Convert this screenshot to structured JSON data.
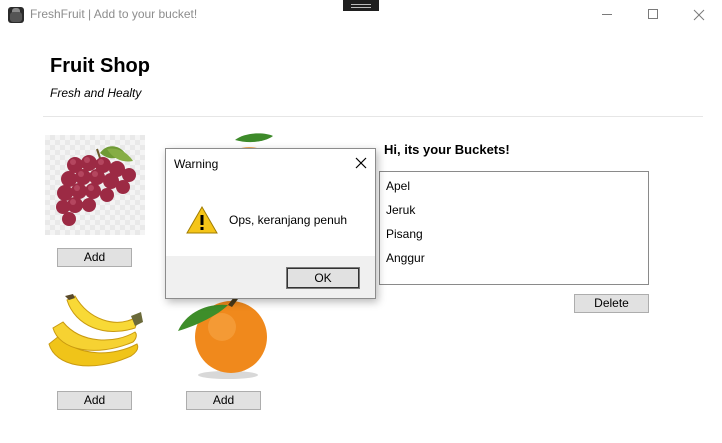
{
  "window": {
    "title": "FreshFruit | Add to your bucket!"
  },
  "header": {
    "title": "Fruit Shop",
    "subtitle": "Fresh and Healty"
  },
  "products": {
    "grape_add": "Add",
    "banana_add": "Add",
    "orange_add": "Add"
  },
  "bucket": {
    "title": "Hi, its your Buckets!",
    "items": [
      "Apel",
      "Jeruk",
      "Pisang",
      "Anggur"
    ],
    "delete_label": "Delete"
  },
  "dialog": {
    "title": "Warning",
    "message": "Ops, keranjang penuh",
    "ok_label": "OK",
    "icon": "warning-icon"
  }
}
